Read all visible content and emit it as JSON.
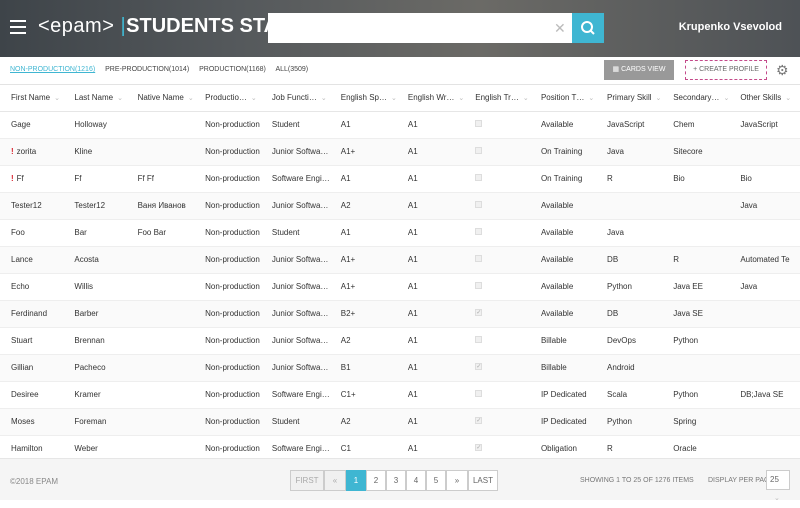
{
  "header": {
    "logo_brand": "<epam>",
    "app_title": "STUDENTS STATISTICS",
    "search_placeholder": "",
    "user_name": "Krupenko Vsevolod"
  },
  "tabs": [
    {
      "label": "NON-PRODUCTION(1216)"
    },
    {
      "label": "PRE-PRODUCTION(1014)"
    },
    {
      "label": "PRODUCTION(1168)"
    },
    {
      "label": "ALL(3509)"
    }
  ],
  "toolbar": {
    "cards_view": "CARDS VIEW",
    "create_profile": "CREATE PROFILE"
  },
  "columns": [
    "First Name",
    "Last Name",
    "Native Name",
    "Productio…",
    "Job Functi…",
    "English Sp…",
    "English Wr…",
    "English Tr…",
    "Position T…",
    "Primary Skill",
    "Secondary…",
    "Other Skills"
  ],
  "rows": [
    {
      "first": "Gage",
      "last": "Holloway",
      "native": "",
      "prod": "Non-production",
      "job": "Student",
      "esp": "A1",
      "ewr": "A1",
      "etr": false,
      "pos": "Available",
      "primary": "JavaScript",
      "secondary": "Chem",
      "other": "JavaScript",
      "warn": false
    },
    {
      "first": "zorita",
      "last": "Kline",
      "native": "",
      "prod": "Non-production",
      "job": "Junior Softwa…",
      "esp": "A1+",
      "ewr": "A1",
      "etr": false,
      "pos": "On Training",
      "primary": "Java",
      "secondary": "Sitecore",
      "other": "",
      "warn": true
    },
    {
      "first": "Ff",
      "last": "Ff",
      "native": "Ff Ff",
      "prod": "Non-production",
      "job": "Software Engi…",
      "esp": "A1",
      "ewr": "A1",
      "etr": false,
      "pos": "On Training",
      "primary": "R",
      "secondary": "Bio",
      "other": "Bio",
      "warn": true
    },
    {
      "first": "Tester12",
      "last": "Tester12",
      "native": "Ваня Иванов",
      "prod": "Non-production",
      "job": "Junior Softwa…",
      "esp": "A2",
      "ewr": "A1",
      "etr": false,
      "pos": "Available",
      "primary": "",
      "secondary": "",
      "other": "Java",
      "warn": false
    },
    {
      "first": "Foo",
      "last": "Bar",
      "native": "Foo Bar",
      "prod": "Non-production",
      "job": "Student",
      "esp": "A1",
      "ewr": "A1",
      "etr": false,
      "pos": "Available",
      "primary": "Java",
      "secondary": "",
      "other": "",
      "warn": false
    },
    {
      "first": "Lance",
      "last": "Acosta",
      "native": "",
      "prod": "Non-production",
      "job": "Junior Softwa…",
      "esp": "A1+",
      "ewr": "A1",
      "etr": false,
      "pos": "Available",
      "primary": "DB",
      "secondary": "R",
      "other": "Automated Te",
      "warn": false
    },
    {
      "first": "Echo",
      "last": "Willis",
      "native": "",
      "prod": "Non-production",
      "job": "Junior Softwa…",
      "esp": "A1+",
      "ewr": "A1",
      "etr": false,
      "pos": "Available",
      "primary": "Python",
      "secondary": "Java EE",
      "other": "Java",
      "warn": false
    },
    {
      "first": "Ferdinand",
      "last": "Barber",
      "native": "",
      "prod": "Non-production",
      "job": "Junior Softwa…",
      "esp": "B2+",
      "ewr": "A1",
      "etr": true,
      "pos": "Available",
      "primary": "DB",
      "secondary": "Java SE",
      "other": "",
      "warn": false
    },
    {
      "first": "Stuart",
      "last": "Brennan",
      "native": "",
      "prod": "Non-production",
      "job": "Junior Softwa…",
      "esp": "A2",
      "ewr": "A1",
      "etr": false,
      "pos": "Billable",
      "primary": "DevOps",
      "secondary": "Python",
      "other": "",
      "warn": false
    },
    {
      "first": "Gillian",
      "last": "Pacheco",
      "native": "",
      "prod": "Non-production",
      "job": "Junior Softwa…",
      "esp": "B1",
      "ewr": "A1",
      "etr": true,
      "pos": "Billable",
      "primary": "Android",
      "secondary": "",
      "other": "",
      "warn": false
    },
    {
      "first": "Desiree",
      "last": "Kramer",
      "native": "",
      "prod": "Non-production",
      "job": "Software Engi…",
      "esp": "C1+",
      "ewr": "A1",
      "etr": false,
      "pos": "IP Dedicated",
      "primary": "Scala",
      "secondary": "Python",
      "other": "DB;Java SE",
      "warn": false
    },
    {
      "first": "Moses",
      "last": "Foreman",
      "native": "",
      "prod": "Non-production",
      "job": "Student",
      "esp": "A2",
      "ewr": "A1",
      "etr": true,
      "pos": "IP Dedicated",
      "primary": "Python",
      "secondary": "Spring",
      "other": "",
      "warn": false
    },
    {
      "first": "Hamilton",
      "last": "Weber",
      "native": "",
      "prod": "Non-production",
      "job": "Software Engi…",
      "esp": "C1",
      "ewr": "A1",
      "etr": true,
      "pos": "Obligation",
      "primary": "R",
      "secondary": "Oracle",
      "other": "",
      "warn": false
    }
  ],
  "footer": {
    "copyright": "©2018 EPAM",
    "first": "FIRST",
    "prev": "«",
    "pages": [
      "1",
      "2",
      "3",
      "4",
      "5"
    ],
    "next": "»",
    "last": "LAST",
    "showing": "SHOWING 1 TO 25 OF 1276 ITEMS",
    "per_page_label": "DISPLAY PER PAGE",
    "per_page_value": "25"
  },
  "colors": {
    "accent": "#3fb6d2",
    "warning": "#d9232e",
    "create_border": "#c44a8a"
  }
}
